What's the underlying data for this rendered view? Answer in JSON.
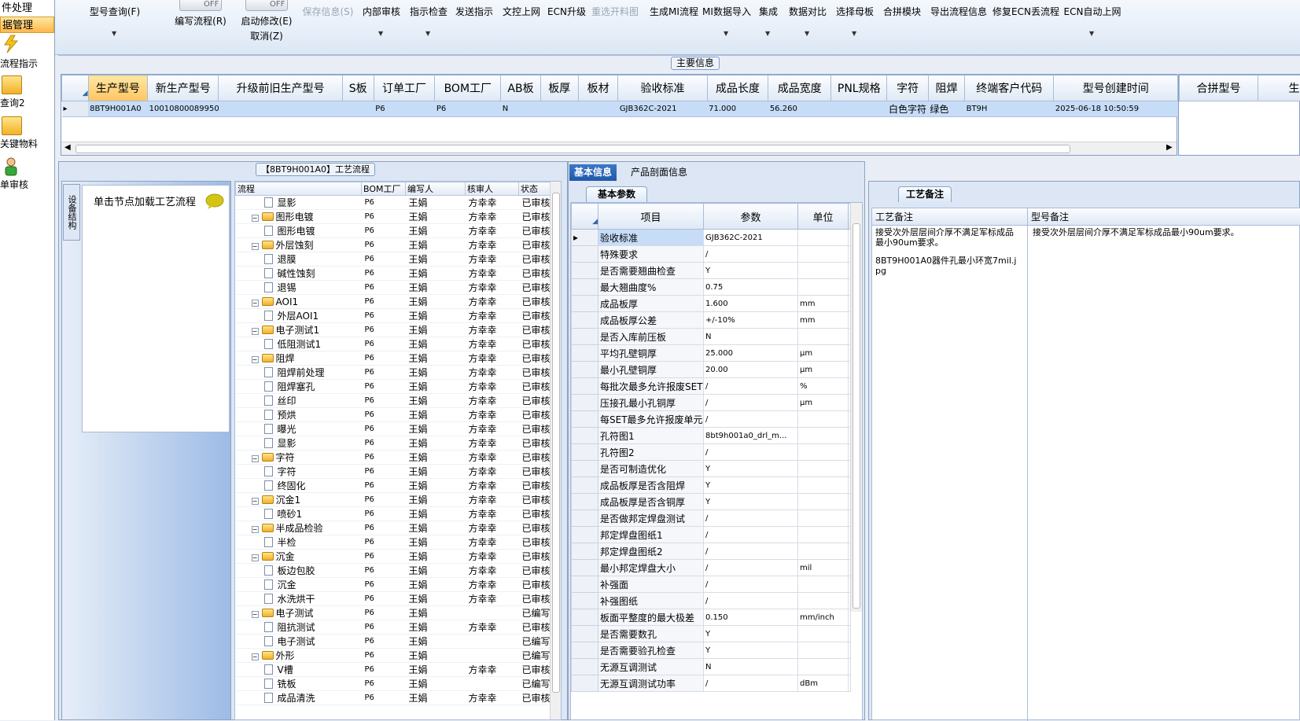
{
  "nav": {
    "headers": [
      "件处理",
      "据管理"
    ],
    "items": [
      {
        "label": "流程指示",
        "icon": "lightning-icon"
      },
      {
        "label": "查询2",
        "icon": "folder-icon"
      },
      {
        "label": "关键物料",
        "icon": "folder-icon"
      },
      {
        "label": "单审核",
        "icon": "user-icon"
      }
    ]
  },
  "ribbon": {
    "buttons": [
      {
        "label": "型号查询(F)",
        "dropdown": true
      },
      {
        "label": "编写流程(R)",
        "toggle": "OFF"
      },
      {
        "label": "启动修改(E)",
        "label2": "取消(Z)",
        "toggle": "OFF"
      },
      {
        "label": "保存信息(S)",
        "disabled": true
      },
      {
        "label": "内部审核",
        "dropdown": true
      },
      {
        "label": "指示检查",
        "dropdown": true
      },
      {
        "label": "发送指示"
      },
      {
        "label": "文控上网"
      },
      {
        "label": "ECN升级"
      },
      {
        "label": "重选开料图",
        "disabled": true
      },
      {
        "label": "生成MI流程"
      },
      {
        "label": "MI数据导入",
        "dropdown": true
      },
      {
        "label": "集成",
        "dropdown": true
      },
      {
        "label": "数据对比",
        "dropdown": true
      },
      {
        "label": "选择母板",
        "dropdown": true
      },
      {
        "label": "合拼模块"
      },
      {
        "label": "导出流程信息"
      },
      {
        "label": "修复ECN丢流程"
      },
      {
        "label": "ECN自动上网",
        "dropdown": true
      }
    ]
  },
  "main_info": {
    "title": "主要信息",
    "columns": [
      "生产型号",
      "新生产型号",
      "升级前旧生产型号",
      "S板",
      "订单工厂",
      "BOM工厂",
      "AB板",
      "板厚",
      "板材",
      "验收标准",
      "成品长度",
      "成品宽度",
      "PNL规格",
      "字符",
      "阻焊",
      "终端客户代码",
      "型号创建时间"
    ],
    "row": [
      "8BT9H001A0",
      "10010800089950",
      "",
      "",
      "P6",
      "P6",
      "N",
      "",
      "",
      "GJB362C-2021",
      "71.000",
      "56.260",
      "",
      "白色字符",
      "绿色",
      "BT9H",
      "2025-06-18 10:50:59"
    ],
    "side_columns": [
      "合拼型号",
      "生产型"
    ]
  },
  "left_panel": {
    "vertical_tab": "设备结构",
    "hint": "单击节点加载工艺流程"
  },
  "process": {
    "title": "【8BT9H001A0】工艺流程",
    "columns": [
      "流程",
      "BOM工厂",
      "编写人",
      "核审人",
      "状态"
    ],
    "rows": [
      {
        "name": "显影",
        "level": 2,
        "bom": "P6",
        "writer": "王娟",
        "reviewer": "方幸幸",
        "status": "已审核"
      },
      {
        "name": "图形电镀",
        "level": 1,
        "bom": "P6",
        "writer": "王娟",
        "reviewer": "方幸幸",
        "status": "已审核"
      },
      {
        "name": "图形电镀",
        "level": 2,
        "bom": "P6",
        "writer": "王娟",
        "reviewer": "方幸幸",
        "status": "已审核"
      },
      {
        "name": "外层蚀刻",
        "level": 1,
        "bom": "P6",
        "writer": "王娟",
        "reviewer": "方幸幸",
        "status": "已审核"
      },
      {
        "name": "退膜",
        "level": 2,
        "bom": "P6",
        "writer": "王娟",
        "reviewer": "方幸幸",
        "status": "已审核"
      },
      {
        "name": "碱性蚀刻",
        "level": 2,
        "bom": "P6",
        "writer": "王娟",
        "reviewer": "方幸幸",
        "status": "已审核"
      },
      {
        "name": "退锡",
        "level": 2,
        "bom": "P6",
        "writer": "王娟",
        "reviewer": "方幸幸",
        "status": "已审核"
      },
      {
        "name": "AOI1",
        "level": 1,
        "bom": "P6",
        "writer": "王娟",
        "reviewer": "方幸幸",
        "status": "已审核"
      },
      {
        "name": "外层AOI1",
        "level": 2,
        "bom": "P6",
        "writer": "王娟",
        "reviewer": "方幸幸",
        "status": "已审核"
      },
      {
        "name": "电子测试1",
        "level": 1,
        "bom": "P6",
        "writer": "王娟",
        "reviewer": "方幸幸",
        "status": "已审核"
      },
      {
        "name": "低阻测试1",
        "level": 2,
        "bom": "P6",
        "writer": "王娟",
        "reviewer": "方幸幸",
        "status": "已审核"
      },
      {
        "name": "阻焊",
        "level": 1,
        "bom": "P6",
        "writer": "王娟",
        "reviewer": "方幸幸",
        "status": "已审核"
      },
      {
        "name": "阻焊前处理",
        "level": 2,
        "bom": "P6",
        "writer": "王娟",
        "reviewer": "方幸幸",
        "status": "已审核"
      },
      {
        "name": "阻焊塞孔",
        "level": 2,
        "bom": "P6",
        "writer": "王娟",
        "reviewer": "方幸幸",
        "status": "已审核"
      },
      {
        "name": "丝印",
        "level": 2,
        "bom": "P6",
        "writer": "王娟",
        "reviewer": "方幸幸",
        "status": "已审核"
      },
      {
        "name": "预烘",
        "level": 2,
        "bom": "P6",
        "writer": "王娟",
        "reviewer": "方幸幸",
        "status": "已审核"
      },
      {
        "name": "曝光",
        "level": 2,
        "bom": "P6",
        "writer": "王娟",
        "reviewer": "方幸幸",
        "status": "已审核"
      },
      {
        "name": "显影",
        "level": 2,
        "bom": "P6",
        "writer": "王娟",
        "reviewer": "方幸幸",
        "status": "已审核"
      },
      {
        "name": "字符",
        "level": 1,
        "bom": "P6",
        "writer": "王娟",
        "reviewer": "方幸幸",
        "status": "已审核"
      },
      {
        "name": "字符",
        "level": 2,
        "bom": "P6",
        "writer": "王娟",
        "reviewer": "方幸幸",
        "status": "已审核"
      },
      {
        "name": "终固化",
        "level": 2,
        "bom": "P6",
        "writer": "王娟",
        "reviewer": "方幸幸",
        "status": "已审核"
      },
      {
        "name": "沉金1",
        "level": 1,
        "bom": "P6",
        "writer": "王娟",
        "reviewer": "方幸幸",
        "status": "已审核"
      },
      {
        "name": "喷砂1",
        "level": 2,
        "bom": "P6",
        "writer": "王娟",
        "reviewer": "方幸幸",
        "status": "已审核"
      },
      {
        "name": "半成品检验",
        "level": 1,
        "bom": "P6",
        "writer": "王娟",
        "reviewer": "方幸幸",
        "status": "已审核"
      },
      {
        "name": "半检",
        "level": 2,
        "bom": "P6",
        "writer": "王娟",
        "reviewer": "方幸幸",
        "status": "已审核"
      },
      {
        "name": "沉金",
        "level": 1,
        "bom": "P6",
        "writer": "王娟",
        "reviewer": "方幸幸",
        "status": "已审核"
      },
      {
        "name": "板边包胶",
        "level": 2,
        "bom": "P6",
        "writer": "王娟",
        "reviewer": "方幸幸",
        "status": "已审核"
      },
      {
        "name": "沉金",
        "level": 2,
        "bom": "P6",
        "writer": "王娟",
        "reviewer": "方幸幸",
        "status": "已审核"
      },
      {
        "name": "水洗烘干",
        "level": 2,
        "bom": "P6",
        "writer": "王娟",
        "reviewer": "方幸幸",
        "status": "已审核"
      },
      {
        "name": "电子测试",
        "level": 1,
        "bom": "P6",
        "writer": "王娟",
        "reviewer": "",
        "status": "已编写"
      },
      {
        "name": "阻抗测试",
        "level": 2,
        "bom": "P6",
        "writer": "王娟",
        "reviewer": "方幸幸",
        "status": "已审核"
      },
      {
        "name": "电子测试",
        "level": 2,
        "bom": "P6",
        "writer": "王娟",
        "reviewer": "",
        "status": "已编写"
      },
      {
        "name": "外形",
        "level": 1,
        "bom": "P6",
        "writer": "王娟",
        "reviewer": "",
        "status": "已编写"
      },
      {
        "name": "V槽",
        "level": 2,
        "bom": "P6",
        "writer": "王娟",
        "reviewer": "方幸幸",
        "status": "已审核"
      },
      {
        "name": "铣板",
        "level": 2,
        "bom": "P6",
        "writer": "王娟",
        "reviewer": "",
        "status": "已编写"
      },
      {
        "name": "成品清洗",
        "level": 2,
        "bom": "P6",
        "writer": "王娟",
        "reviewer": "方幸幸",
        "status": "已审核"
      }
    ]
  },
  "basic": {
    "tabs": [
      "基本信息",
      "产品剖面信息"
    ],
    "subtab": "基本参数",
    "columns": [
      "项目",
      "参数",
      "单位"
    ],
    "rows": [
      {
        "item": "验收标准",
        "value": "GJB362C-2021",
        "unit": ""
      },
      {
        "item": "特殊要求",
        "value": "/",
        "unit": ""
      },
      {
        "item": "是否需要翘曲检查",
        "value": "Y",
        "unit": ""
      },
      {
        "item": "最大翘曲度%",
        "value": "0.75",
        "unit": ""
      },
      {
        "item": "成品板厚",
        "value": "1.600",
        "unit": "mm"
      },
      {
        "item": "成品板厚公差",
        "value": "+/-10%",
        "unit": "mm"
      },
      {
        "item": "是否入库前压板",
        "value": "N",
        "unit": ""
      },
      {
        "item": "平均孔壁铜厚",
        "value": "25.000",
        "unit": "μm"
      },
      {
        "item": "最小孔壁铜厚",
        "value": "20.00",
        "unit": "μm"
      },
      {
        "item": "每批次最多允许报废SET",
        "value": "/",
        "unit": "%"
      },
      {
        "item": "压接孔最小孔铜厚",
        "value": "/",
        "unit": "μm"
      },
      {
        "item": "每SET最多允许报废单元",
        "value": "/",
        "unit": ""
      },
      {
        "item": "孔符图1",
        "value": "8bt9h001a0_drl_m...",
        "unit": ""
      },
      {
        "item": "孔符图2",
        "value": "/",
        "unit": ""
      },
      {
        "item": "是否可制造优化",
        "value": "Y",
        "unit": ""
      },
      {
        "item": "成品板厚是否含阻焊",
        "value": "Y",
        "unit": ""
      },
      {
        "item": "成品板厚是否含铜厚",
        "value": "Y",
        "unit": ""
      },
      {
        "item": "是否做邦定焊盘测试",
        "value": "/",
        "unit": ""
      },
      {
        "item": "邦定焊盘图纸1",
        "value": "/",
        "unit": ""
      },
      {
        "item": "邦定焊盘图纸2",
        "value": "/",
        "unit": ""
      },
      {
        "item": "最小邦定焊盘大小",
        "value": "/",
        "unit": "mil"
      },
      {
        "item": "补强面",
        "value": "/",
        "unit": ""
      },
      {
        "item": "补强图纸",
        "value": "/",
        "unit": ""
      },
      {
        "item": "板面平整度的最大极差",
        "value": "0.150",
        "unit": "mm/inch"
      },
      {
        "item": "是否需要数孔",
        "value": "Y",
        "unit": ""
      },
      {
        "item": "是否需要验孔检查",
        "value": "Y",
        "unit": ""
      },
      {
        "item": "无源互调测试",
        "value": "N",
        "unit": ""
      },
      {
        "item": "无源互调测试功率",
        "value": "/",
        "unit": "dBm"
      }
    ]
  },
  "notes": {
    "tab": "工艺备注",
    "col1": "工艺备注",
    "col2": "型号备注",
    "text1a": "接受次外层层间介厚不满足军标成品最小90um要求。",
    "text1b": "8BT9H001A0器件孔最小环宽7mil.jpg",
    "text2": "接受次外层层间介厚不满足军标成品最小90um要求。"
  }
}
